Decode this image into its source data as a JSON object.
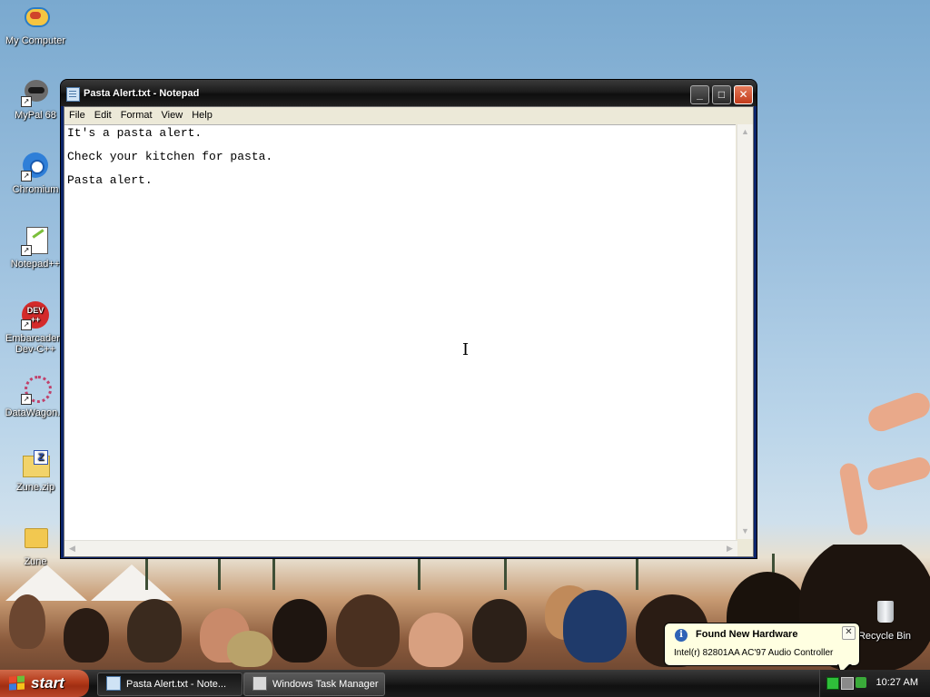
{
  "desktop": {
    "icons": [
      {
        "label": "My Computer"
      },
      {
        "label": "MyPal 68"
      },
      {
        "label": "Chromium"
      },
      {
        "label": "Notepad++"
      },
      {
        "label": "Embarcadero Dev-C++"
      },
      {
        "label": "DataWagon..."
      },
      {
        "label": "Zune.zip"
      },
      {
        "label": "Zune"
      },
      {
        "label": "Recycle Bin"
      }
    ]
  },
  "window": {
    "title": "Pasta Alert.txt - Notepad",
    "buttons": {
      "minimize": "_",
      "maximize": "□",
      "close": "✕"
    },
    "menu": [
      "File",
      "Edit",
      "Format",
      "View",
      "Help"
    ],
    "content_lines": [
      "It's a pasta alert.",
      "Check your kitchen for pasta.",
      "Pasta alert."
    ],
    "cursor_glyph": "I"
  },
  "balloon": {
    "title": "Found New Hardware",
    "text": "Intel(r) 82801AA AC'97 Audio Controller",
    "close": "✕"
  },
  "taskbar": {
    "start_label": "start",
    "tasks": [
      {
        "label": "Pasta Alert.txt - Note...",
        "state": "active"
      },
      {
        "label": "Windows Task Manager",
        "state": "inactive"
      }
    ],
    "clock": "10:27 AM"
  },
  "colors": {
    "start_button": "#b33a1a",
    "taskbar": "#1b1b1b",
    "balloon_bg": "#ffffe1",
    "close_button": "#c23b1b"
  },
  "icons": {
    "app": "notepad-icon",
    "info": "info-icon",
    "tray": [
      "network-icon",
      "task-manager-icon",
      "safely-remove-hardware-icon",
      "keyboard-icon"
    ]
  }
}
